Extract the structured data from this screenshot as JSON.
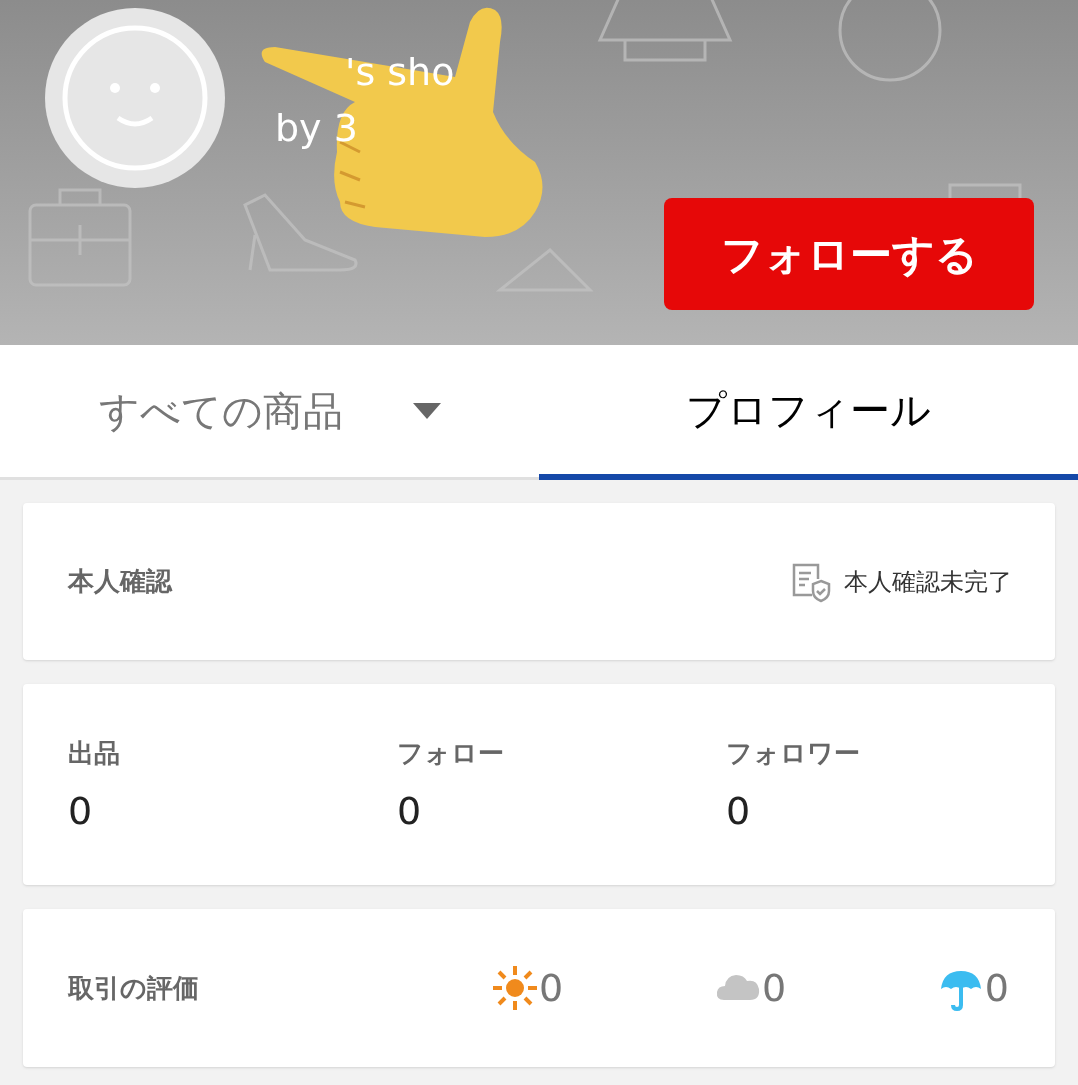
{
  "header": {
    "shop_name": "'s sho",
    "owner": "by 3",
    "follow_button": "フォローする"
  },
  "tabs": [
    {
      "label": "すべての商品",
      "selected": false,
      "dropdown": true
    },
    {
      "label": "プロフィール",
      "selected": true,
      "dropdown": false
    }
  ],
  "identity": {
    "label": "本人確認",
    "status": "本人確認未完了"
  },
  "stats": [
    {
      "label": "出品",
      "value": "0"
    },
    {
      "label": "フォロー",
      "value": "0"
    },
    {
      "label": "フォロワー",
      "value": "0"
    }
  ],
  "ratings": {
    "label": "取引の評価",
    "items": [
      {
        "kind": "good",
        "value": "0"
      },
      {
        "kind": "normal",
        "value": "0"
      },
      {
        "kind": "bad",
        "value": "0"
      }
    ]
  }
}
